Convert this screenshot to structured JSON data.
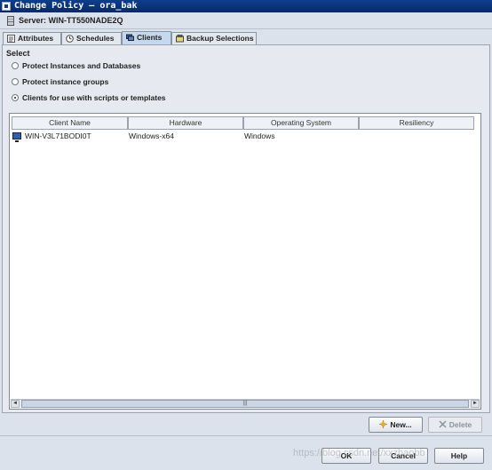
{
  "window": {
    "title": "Change Policy – ora_bak"
  },
  "server": {
    "label": "Server: WIN-TT550NADE2Q"
  },
  "tabs": [
    {
      "label": "Attributes"
    },
    {
      "label": "Schedules"
    },
    {
      "label": "Clients"
    },
    {
      "label": "Backup Selections"
    }
  ],
  "select": {
    "label": "Select",
    "options": [
      {
        "label": "Protect Instances and Databases",
        "checked": false
      },
      {
        "label": "Protect instance groups",
        "checked": false
      },
      {
        "label": "Clients for use with scripts or templates",
        "checked": true
      }
    ]
  },
  "table": {
    "columns": [
      "Client Name",
      "Hardware",
      "Operating System",
      "Resiliency"
    ],
    "rows": [
      {
        "client_name": "WIN-V3L71BODI0T",
        "hardware": "Windows-x64",
        "os": "Windows",
        "resiliency": ""
      }
    ],
    "scroll_left": "◄",
    "scroll_right": "►",
    "scroll_grip": "|||"
  },
  "buttons": {
    "new": "New...",
    "delete": "Delete",
    "ok": "OK",
    "cancel": "Cancel",
    "help": "Help"
  },
  "watermark": "https://blog.csdn.net/xxzhaobb",
  "colors": {
    "title_bar": "#0d3e8e",
    "active_tab": "#c5d8ee",
    "new_icon": "#f2b21a"
  }
}
